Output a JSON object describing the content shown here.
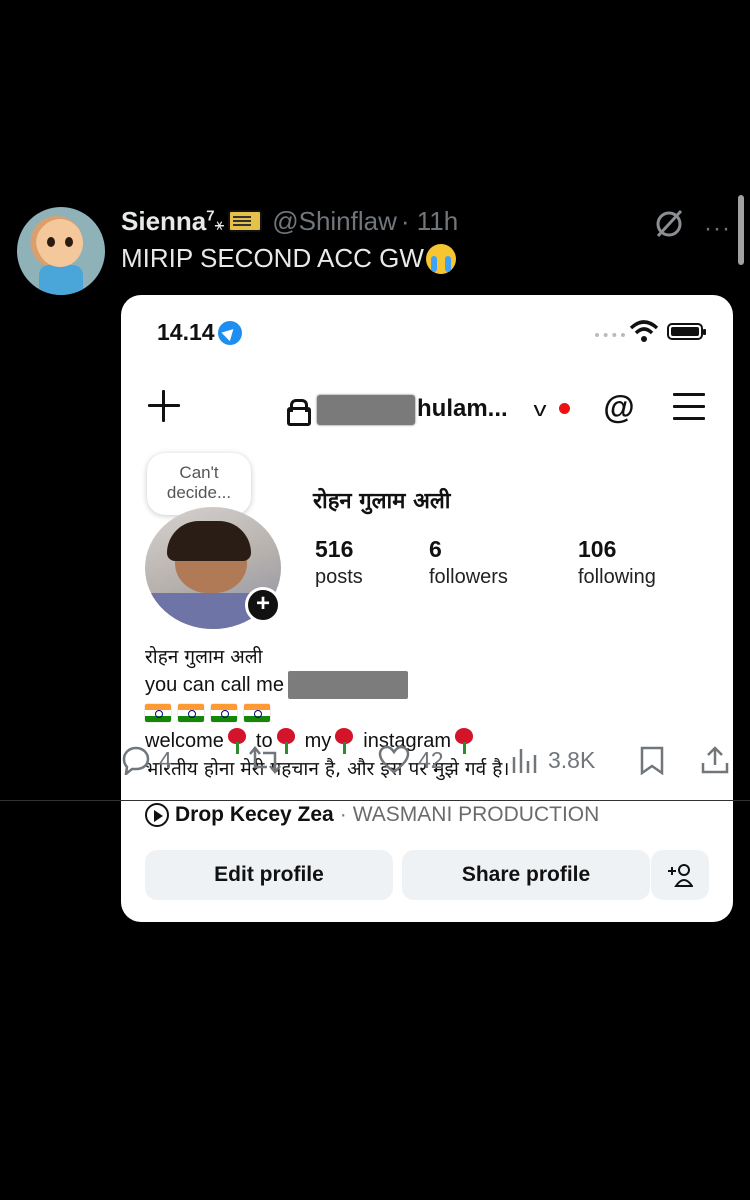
{
  "tweet": {
    "author_name": "Sienna",
    "author_sup": "7",
    "author_tag": "⚹",
    "handle": "@Shinflaw",
    "time": "· 11h",
    "text": "MIRIP SECOND ACC GW",
    "more": "···"
  },
  "screenshot": {
    "status_time": "14.14",
    "username": "hulam...",
    "note": "Can't decide...",
    "profile_name": "रोहन गुलाम अली",
    "stats": [
      {
        "num": "516",
        "label": "posts"
      },
      {
        "num": "6",
        "label": "followers"
      },
      {
        "num": "106",
        "label": "following"
      }
    ],
    "bio_name": "रोहन गुलाम अली",
    "bio_call": "you can call me",
    "bio_welcome": [
      "welcome",
      "to",
      "my",
      "instagram"
    ],
    "bio_hindi": "भारतीय होना मेरी पहचान है, और इस पर मुझे गर्व है।",
    "music_song": "Drop Kecey Zea",
    "music_artist": "WASMANI PRODUCTION",
    "edit_profile": "Edit profile",
    "share_profile": "Share profile",
    "add_person": "+8"
  },
  "actions": {
    "replies": "4",
    "likes": "42",
    "views": "3.8K"
  },
  "colors": {
    "background": "#000000",
    "muted": "#71767b",
    "card": "#ffffff",
    "button": "#eff2f5"
  }
}
